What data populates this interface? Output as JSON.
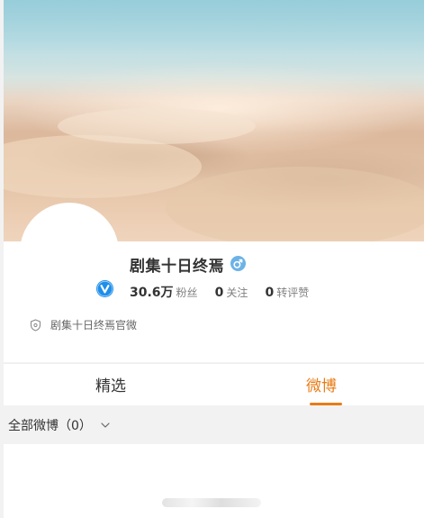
{
  "profile": {
    "username": "剧集十日终焉",
    "gender_icon": "male-icon",
    "verified_icon": "verified-v-icon",
    "stats": [
      {
        "value": "30.6万",
        "label": "粉丝"
      },
      {
        "value": "0",
        "label": "关注"
      },
      {
        "value": "0",
        "label": "转评赞"
      }
    ],
    "bio_icon": "shield-icon",
    "bio": "剧集十日终焉官微"
  },
  "tabs": [
    {
      "label": "精选",
      "active": false
    },
    {
      "label": "微博",
      "active": true
    }
  ],
  "filter": {
    "label": "全部微博（0）",
    "icon": "chevron-down-icon"
  },
  "colors": {
    "accent": "#e87c17",
    "verified": "#1d8eea",
    "gender": "#5aa7e0"
  }
}
